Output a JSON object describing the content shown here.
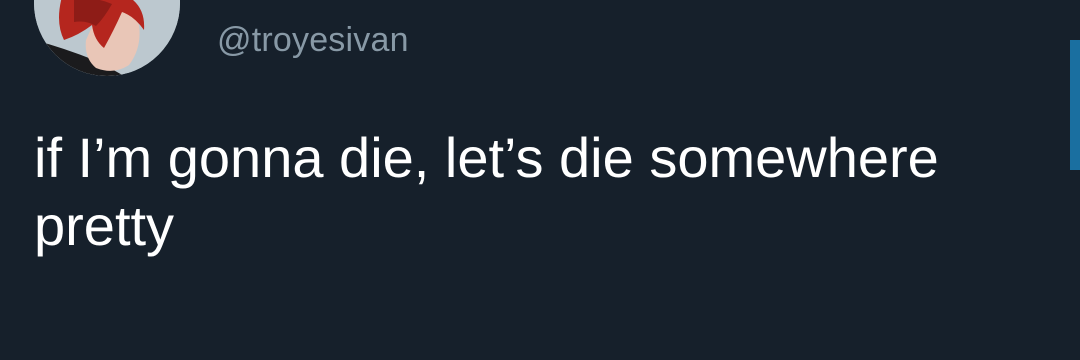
{
  "tweet": {
    "handle": "@troyesivan",
    "text": "if I’m gonna die, let’s die somewhere pretty",
    "avatar_icon": "profile-photo"
  },
  "colors": {
    "background": "#16202b",
    "handle": "#8899a6",
    "text": "#ffffff",
    "accent": "#1a6fa0"
  }
}
